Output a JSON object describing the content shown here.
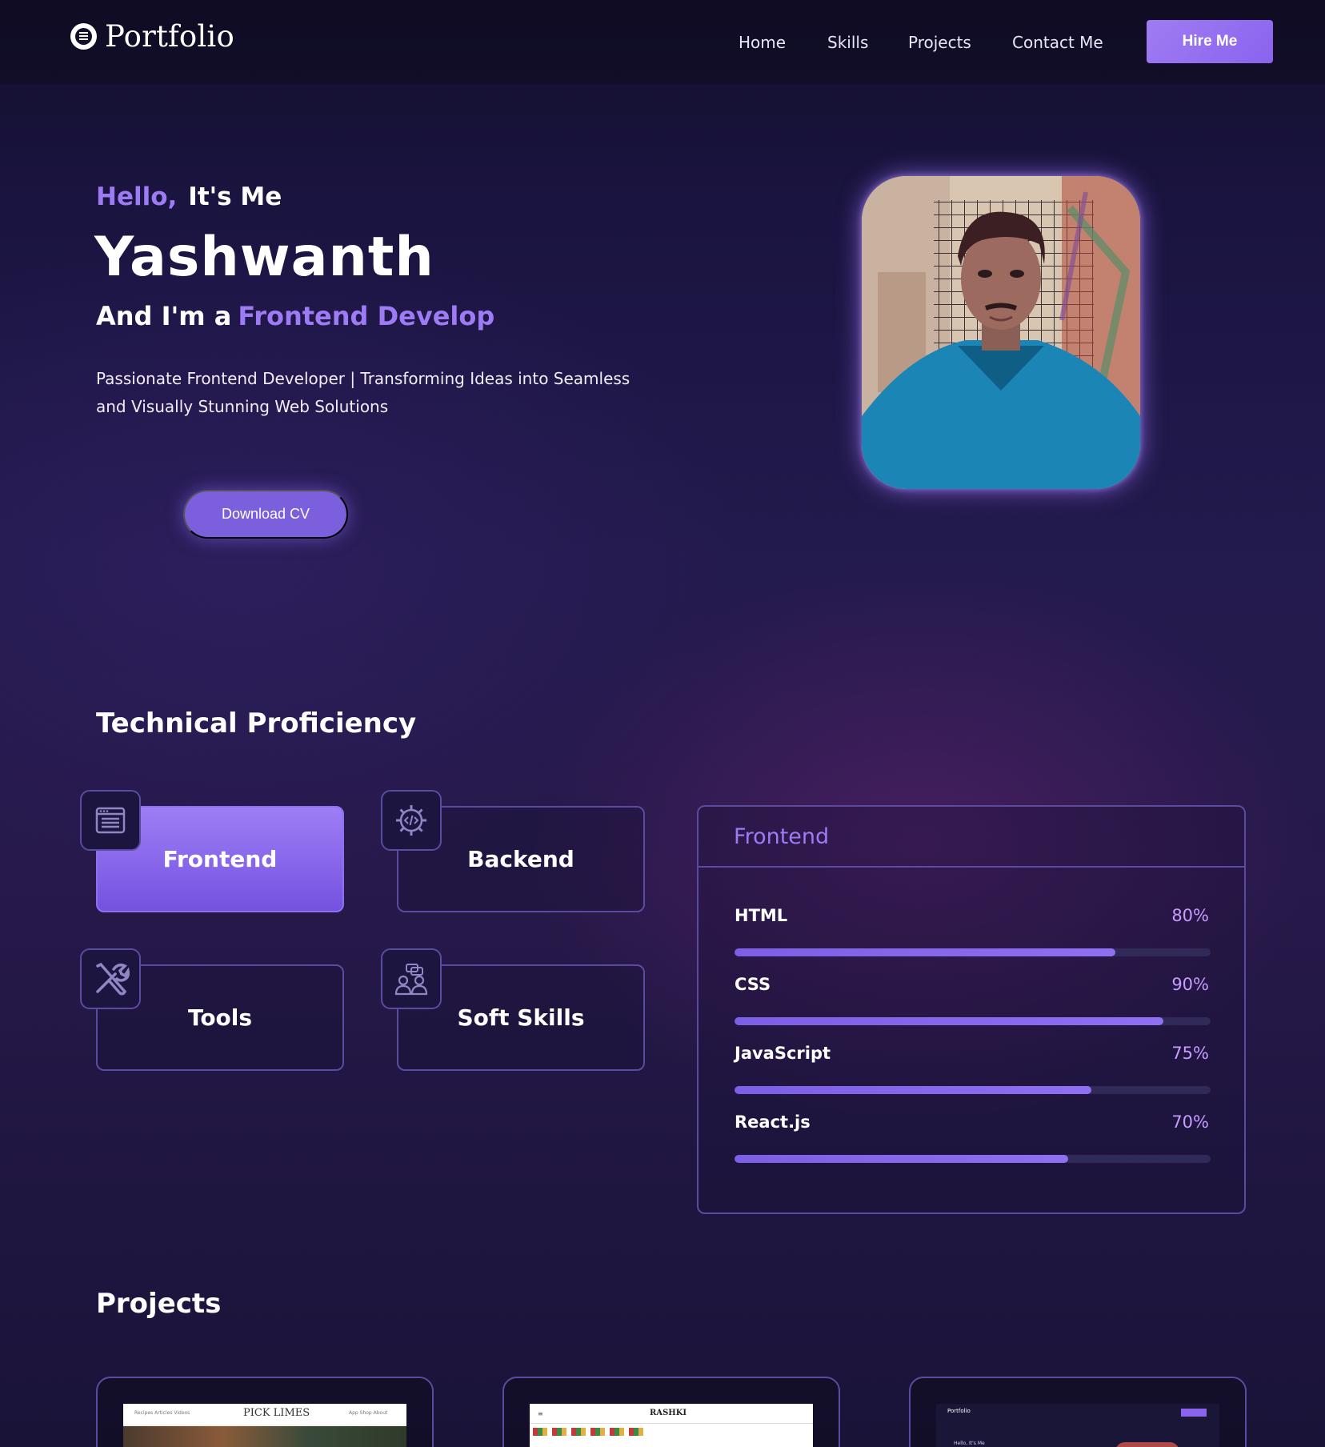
{
  "brand": {
    "logo_text": "Portfolio"
  },
  "nav": {
    "links": [
      "Home",
      "Skills",
      "Projects",
      "Contact Me"
    ],
    "hire_label": "Hire Me"
  },
  "hero": {
    "greeting": "Hello,",
    "greeting_rest": "It's Me",
    "name": "Yashwanth",
    "role_prefix": "And I'm a",
    "role": "Frontend Develop",
    "description": "Passionate Frontend Developer | Transforming Ideas into Seamless and Visually Stunning Web Solutions",
    "cv_label": "Download CV"
  },
  "tech": {
    "title": "Technical Proficiency",
    "categories": [
      {
        "label": "Frontend",
        "icon": "browser-window-icon",
        "active": true
      },
      {
        "label": "Backend",
        "icon": "code-gear-icon",
        "active": false
      },
      {
        "label": "Tools",
        "icon": "wrench-screwdriver-icon",
        "active": false
      },
      {
        "label": "Soft Skills",
        "icon": "people-chat-icon",
        "active": false
      }
    ],
    "panel": {
      "title": "Frontend",
      "skills": [
        {
          "name": "HTML",
          "percent_label": "80%",
          "level": 0.8
        },
        {
          "name": "CSS",
          "percent_label": "90%",
          "level": 0.9
        },
        {
          "name": "JavaScript",
          "percent_label": "75%",
          "level": 0.75
        },
        {
          "name": "React.js",
          "percent_label": "70%",
          "level": 0.7
        }
      ]
    }
  },
  "projects": {
    "title": "Projects",
    "cards": [
      {
        "thumb_brand": "PICK LIMES",
        "thumb_nav": "Recipes  Articles  Videos",
        "thumb_right": "App  Shop  About"
      },
      {
        "thumb_brand": "RASHKI"
      },
      {
        "thumb_brand": "Portfolio",
        "thumb_hello": "Hello, It's Me"
      }
    ]
  },
  "colors": {
    "accent": "#9d7bf4",
    "button": "#8a63ee",
    "card_border": "#5b4ba0",
    "percent": "#c79bff"
  }
}
